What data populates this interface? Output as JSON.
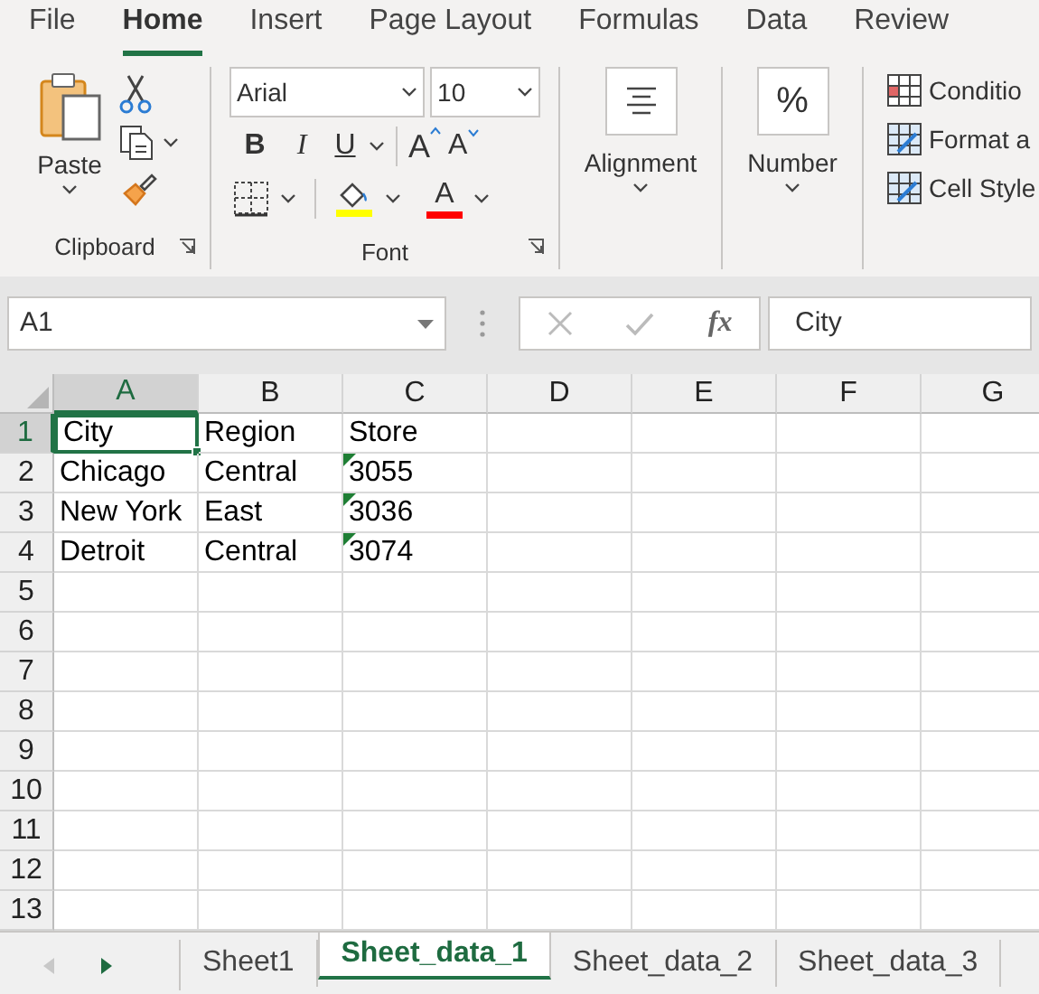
{
  "menu_tabs": [
    {
      "label": "File",
      "selected": false
    },
    {
      "label": "Home",
      "selected": true
    },
    {
      "label": "Insert",
      "selected": false
    },
    {
      "label": "Page Layout",
      "selected": false
    },
    {
      "label": "Formulas",
      "selected": false
    },
    {
      "label": "Data",
      "selected": false
    },
    {
      "label": "Review",
      "selected": false
    }
  ],
  "ribbon": {
    "clipboard": {
      "label": "Clipboard",
      "paste": "Paste"
    },
    "font": {
      "label": "Font",
      "font_name": "Arial",
      "font_size": "10",
      "bold": "B",
      "italic": "I",
      "underline": "U",
      "grow": "A",
      "shrink": "A",
      "font_color": "A"
    },
    "alignment": {
      "label": "Alignment"
    },
    "number": {
      "label": "Number",
      "symbol": "%"
    },
    "styles": [
      "Conditio",
      "Format a",
      "Cell Style"
    ]
  },
  "formula_bar": {
    "name_box": "A1",
    "fx": "fx",
    "formula": "City"
  },
  "columns": [
    {
      "label": "A",
      "selected": true
    },
    {
      "label": "B",
      "selected": false
    },
    {
      "label": "C",
      "selected": false
    },
    {
      "label": "D",
      "selected": false
    },
    {
      "label": "E",
      "selected": false
    },
    {
      "label": "F",
      "selected": false
    },
    {
      "label": "G",
      "selected": false
    }
  ],
  "rows": [
    {
      "label": "1",
      "selected": true,
      "cells": [
        {
          "text": "City",
          "active": true,
          "flagged": false
        },
        {
          "text": "Region",
          "active": false,
          "flagged": false
        },
        {
          "text": "Store",
          "active": false,
          "flagged": false
        }
      ]
    },
    {
      "label": "2",
      "selected": false,
      "cells": [
        {
          "text": "Chicago",
          "active": false,
          "flagged": false
        },
        {
          "text": "Central",
          "active": false,
          "flagged": false
        },
        {
          "text": "3055",
          "active": false,
          "flagged": true
        }
      ]
    },
    {
      "label": "3",
      "selected": false,
      "cells": [
        {
          "text": "New York",
          "active": false,
          "flagged": false
        },
        {
          "text": "East",
          "active": false,
          "flagged": false
        },
        {
          "text": "3036",
          "active": false,
          "flagged": true
        }
      ]
    },
    {
      "label": "4",
      "selected": false,
      "cells": [
        {
          "text": "Detroit",
          "active": false,
          "flagged": false
        },
        {
          "text": "Central",
          "active": false,
          "flagged": false
        },
        {
          "text": "3074",
          "active": false,
          "flagged": true
        }
      ]
    },
    {
      "label": "5",
      "selected": false,
      "cells": []
    },
    {
      "label": "6",
      "selected": false,
      "cells": []
    },
    {
      "label": "7",
      "selected": false,
      "cells": []
    },
    {
      "label": "8",
      "selected": false,
      "cells": []
    },
    {
      "label": "9",
      "selected": false,
      "cells": []
    },
    {
      "label": "10",
      "selected": false,
      "cells": []
    },
    {
      "label": "11",
      "selected": false,
      "cells": []
    },
    {
      "label": "12",
      "selected": false,
      "cells": []
    },
    {
      "label": "13",
      "selected": false,
      "cells": []
    }
  ],
  "sheet_tabs": [
    {
      "label": "Sheet1",
      "selected": false
    },
    {
      "label": "Sheet_data_1",
      "selected": true
    },
    {
      "label": "Sheet_data_2",
      "selected": false
    },
    {
      "label": "Sheet_data_3",
      "selected": false
    }
  ]
}
